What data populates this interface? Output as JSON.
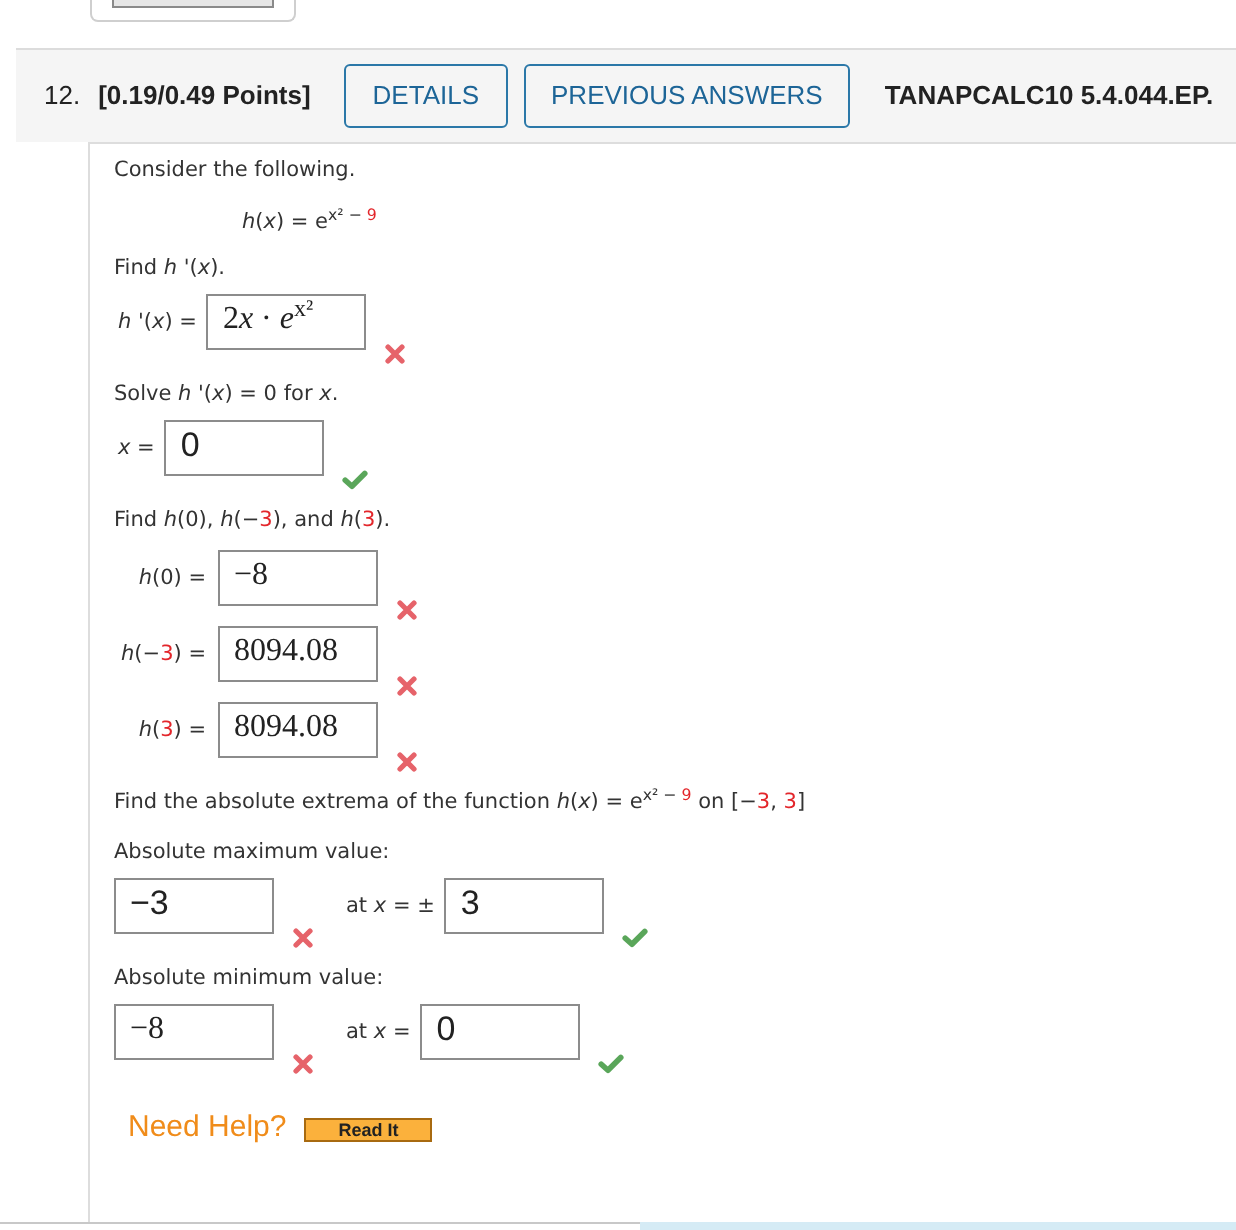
{
  "question": {
    "number": "12.",
    "points": "[0.19/0.49 Points]",
    "buttons": [
      "DETAILS",
      "PREVIOUS ANSWERS"
    ],
    "code": "TANAPCALC10 5.4.044.EP."
  },
  "body": [
    {
      "kind": "text",
      "parts": [
        {
          "text": "Consider the following."
        }
      ]
    },
    {
      "kind": "formula",
      "parts": [
        {
          "text": "*h*(*x*) = e$^{x² − }$"
        },
        {
          "text": "$^{9}$",
          "color": "#e3262b"
        }
      ]
    },
    {
      "kind": "text",
      "parts": [
        {
          "text": "Find *h* '(*x*)."
        }
      ]
    },
    {
      "kind": "answer_line",
      "fields": [
        {
          "label": [
            {
              "text": "*h* '(*x*) ="
            }
          ],
          "kind": "math",
          "value": [
            {
              "text": "2"
            },
            {
              "text": "*x* · *e*$^{x²}$"
            }
          ],
          "correct": false
        }
      ]
    },
    {
      "kind": "text",
      "parts": [
        {
          "text": "Solve *h* '(*x*) = 0 for *x*."
        }
      ]
    },
    {
      "kind": "answer_line",
      "fields": [
        {
          "label": [
            {
              "text": "*x* ="
            }
          ],
          "kind": "text",
          "value": [
            {
              "text": "0"
            }
          ],
          "correct": true
        }
      ]
    },
    {
      "kind": "text",
      "parts": [
        {
          "text": "Find *h*(0), *h*(−"
        },
        {
          "text": "3",
          "color": "#e3262b"
        },
        {
          "text": "), and *h*("
        },
        {
          "text": "3",
          "color": "#e3262b"
        },
        {
          "text": ")."
        }
      ]
    },
    {
      "kind": "answer_group",
      "rows": [
        {
          "label": [
            {
              "text": "*h*(0) ="
            }
          ],
          "kind": "math",
          "value": [
            {
              "text": "−8"
            }
          ],
          "correct": false
        },
        {
          "label": [
            {
              "text": "*h*(−"
            },
            {
              "text": "3",
              "color": "#e3262b"
            },
            {
              "text": ") ="
            }
          ],
          "kind": "math",
          "value": [
            {
              "text": "8094.08"
            }
          ],
          "correct": false
        },
        {
          "label": [
            {
              "text": "*h*("
            },
            {
              "text": "3",
              "color": "#e3262b"
            },
            {
              "text": ") ="
            }
          ],
          "kind": "math",
          "value": [
            {
              "text": "8094.08"
            }
          ],
          "correct": false
        }
      ]
    },
    {
      "kind": "text",
      "parts": [
        {
          "text": "Find the absolute extrema of the function *h*(*x*) = e$^{x² − }$"
        },
        {
          "text": "$^{9}$",
          "color": "#e3262b"
        },
        {
          "text": " on [−"
        },
        {
          "text": "3",
          "color": "#e3262b"
        },
        {
          "text": ", "
        },
        {
          "text": "3",
          "color": "#e3262b"
        },
        {
          "text": "]"
        }
      ]
    },
    {
      "kind": "text",
      "parts": [
        {
          "text": "Absolute maximum value:"
        }
      ]
    },
    {
      "kind": "answer_line",
      "fields": [
        {
          "kind": "text",
          "value": [
            {
              "text": "−3"
            }
          ],
          "correct": false
        },
        {
          "label": [
            {
              "text": "at *x* = ±"
            }
          ],
          "kind": "text",
          "value": [
            {
              "text": "3"
            }
          ],
          "correct": true
        }
      ]
    },
    {
      "kind": "text",
      "parts": [
        {
          "text": "Absolute minimum value:"
        }
      ]
    },
    {
      "kind": "answer_line",
      "fields": [
        {
          "kind": "math",
          "value": [
            {
              "text": "−8"
            }
          ],
          "correct": false
        },
        {
          "label": [
            {
              "text": "at *x* ="
            }
          ],
          "kind": "text",
          "value": [
            {
              "text": "0"
            }
          ],
          "correct": true
        }
      ]
    }
  ],
  "help": {
    "label": "Need Help?",
    "buttons": [
      "Read It"
    ]
  }
}
